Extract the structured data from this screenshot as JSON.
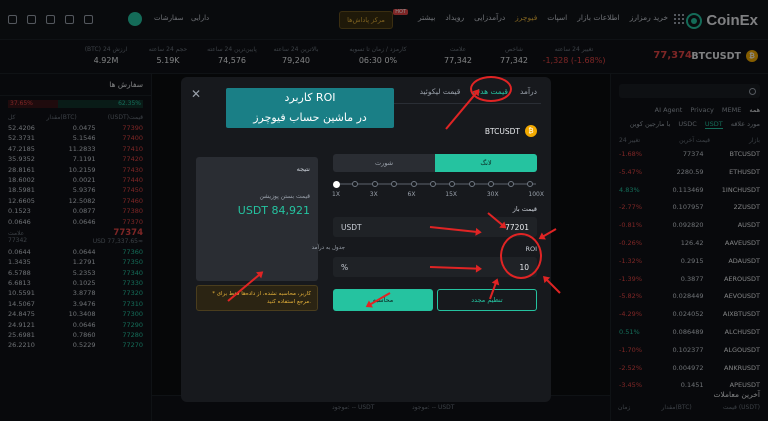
{
  "topbar": {
    "brand": "CoinEx",
    "nav": [
      {
        "label": "خرید رمزارز",
        "active": false
      },
      {
        "label": "اطلاعات بازار",
        "active": false
      },
      {
        "label": "اسپات",
        "active": false
      },
      {
        "label": "فیوچرز",
        "active": true
      },
      {
        "label": "درآمدزایی",
        "active": false
      },
      {
        "label": "رویداد",
        "active": false
      },
      {
        "label": "بیشتر",
        "active": false
      }
    ],
    "hot_badge": "HOT",
    "bot_button": "مرکز پاداش‌ها",
    "assets": "دارایی",
    "orders": "سفارشات"
  },
  "ticker": {
    "pair": "BTCUSDT",
    "price": "77,374",
    "stats": [
      {
        "k": "تغییر 24 ساعته",
        "v": "-1,328 (-1.68%)",
        "red": true
      },
      {
        "k": "شاخص",
        "v": "77,342",
        "red": false
      },
      {
        "k": "علامت",
        "v": "77,342",
        "red": false
      },
      {
        "k": "کارمزد / زمان تا تسویه",
        "v": "06:30 0%",
        "red": false
      },
      {
        "k": "بالاترین 24 ساعته",
        "v": "79,240",
        "red": false
      },
      {
        "k": "پایین‌ترین 24 ساعته",
        "v": "74,576",
        "red": false
      },
      {
        "k": "حجم 24 ساعته",
        "v": "5.19K",
        "red": false
      },
      {
        "k": "(BTC) ارزش 24",
        "v": "4.92M",
        "red": false
      }
    ]
  },
  "orderbook": {
    "title": "سفارش ها",
    "ratio_sell": "37.65%",
    "ratio_buy": "62.35%",
    "cols": [
      "(USDT)قیمت",
      "مقدار(BTC)",
      "کل"
    ],
    "asks": [
      {
        "p": "77390",
        "a": "0.0475",
        "t": "52.4206"
      },
      {
        "p": "77400",
        "a": "5.1546",
        "t": "52.3731"
      },
      {
        "p": "77410",
        "a": "11.2833",
        "t": "47.2185"
      },
      {
        "p": "77420",
        "a": "7.1191",
        "t": "35.9352"
      },
      {
        "p": "77430",
        "a": "10.2159",
        "t": "28.8161"
      },
      {
        "p": "77440",
        "a": "0.0021",
        "t": "18.6002"
      },
      {
        "p": "77450",
        "a": "5.9376",
        "t": "18.5981"
      },
      {
        "p": "77460",
        "a": "12.5082",
        "t": "12.6605"
      },
      {
        "p": "77380",
        "a": "0.0877",
        "t": "0.1523"
      },
      {
        "p": "77370",
        "a": "0.0646",
        "t": "0.0646"
      }
    ],
    "mid_price": "77374",
    "mid_sub": "USD 77,337.65≈",
    "mid_left_top": "علامت",
    "mid_left_bottom": "77342",
    "bids": [
      {
        "p": "77360",
        "a": "0.0644",
        "t": "0.0644"
      },
      {
        "p": "77350",
        "a": "1.2791",
        "t": "1.3435"
      },
      {
        "p": "77340",
        "a": "5.2353",
        "t": "6.5788"
      },
      {
        "p": "77330",
        "a": "0.1025",
        "t": "6.6813"
      },
      {
        "p": "77320",
        "a": "3.8778",
        "t": "10.5591"
      },
      {
        "p": "77310",
        "a": "3.9476",
        "t": "14.5067"
      },
      {
        "p": "77300",
        "a": "10.3408",
        "t": "24.8475"
      },
      {
        "p": "77290",
        "a": "0.0646",
        "t": "24.9121"
      },
      {
        "p": "77280",
        "a": "0.7860",
        "t": "25.6981"
      },
      {
        "p": "77270",
        "a": "0.5229",
        "t": "26.2210"
      }
    ]
  },
  "markets": {
    "search_placeholder": "جستجو",
    "tabs": [
      "همه",
      "MEME",
      "Privacy",
      "AI Agent"
    ],
    "subtabs": [
      "مورد علاقه",
      "USDT",
      "USDC",
      "با مارجین کوین"
    ],
    "cols": [
      "بازار",
      "قیمت آخرین",
      "تغییر 24"
    ],
    "rows": [
      {
        "s": "BTCUSDT",
        "p": "77374",
        "c": "-1.68%",
        "g": false
      },
      {
        "s": "ETHUSDT",
        "p": "2280.59",
        "c": "-5.47%",
        "g": false
      },
      {
        "s": "1INCHUSDT",
        "p": "0.113469",
        "c": "4.83%",
        "g": true
      },
      {
        "s": "2ZUSDT",
        "p": "0.107957",
        "c": "-2.77%",
        "g": false
      },
      {
        "s": "AUSDT",
        "p": "0.092820",
        "c": "-0.81%",
        "g": false
      },
      {
        "s": "AAVEUSDT",
        "p": "126.42",
        "c": "-0.26%",
        "g": false
      },
      {
        "s": "ADAUSDT",
        "p": "0.2915",
        "c": "-1.32%",
        "g": false
      },
      {
        "s": "AEROUSDT",
        "p": "0.3877",
        "c": "-1.39%",
        "g": false
      },
      {
        "s": "AEVOUSDT",
        "p": "0.028449",
        "c": "-5.82%",
        "g": false
      },
      {
        "s": "AIXBTUSDT",
        "p": "0.024052",
        "c": "-4.29%",
        "g": false
      },
      {
        "s": "ALCHUSDT",
        "p": "0.086489",
        "c": "0.51%",
        "g": true
      },
      {
        "s": "ALGOUSDT",
        "p": "0.102377",
        "c": "-1.70%",
        "g": false
      },
      {
        "s": "ANKRUSDT",
        "p": "0.004972",
        "c": "-2.52%",
        "g": false
      },
      {
        "s": "APEUSDT",
        "p": "0.1451",
        "c": "-3.45%",
        "g": false
      }
    ],
    "recent_title": "آخرین معاملات",
    "recent_cols": [
      "زمان",
      "مقدار(BTC)",
      "قیمت (USDT)"
    ]
  },
  "chartbottom": {
    "available1": "موجود: -- USDT",
    "available2": "موجود: -- USDT",
    "futures": "فیوچرز"
  },
  "modal": {
    "tabs": [
      {
        "label": "درآمد",
        "active": false
      },
      {
        "label": "قیمت هدف",
        "active": true
      },
      {
        "label": "قیمت لیکوئید",
        "active": false
      }
    ],
    "pair": "BTCUSDT",
    "annotation_line1": "کاربرد ROI",
    "annotation_line2": "در ماشین حساب فیوچرز",
    "toggle_long": "لانگ",
    "toggle_short": "شورت",
    "leverage_ticks": [
      "1X",
      "3X",
      "6X",
      "15X",
      "30X",
      "100X"
    ],
    "leverage_value": 0,
    "entry_label": "قیمت باز",
    "entry_value": "77201",
    "entry_unit": "USDT",
    "roi_label": "ROI",
    "roi_sublabel": "جدول به درآمد",
    "roi_value": "10",
    "roi_unit": "%",
    "result_title": "نتیجه",
    "result_key": "قیمت بستن پوزیشن",
    "result_value": "USDT 84,921",
    "warning": "* کاربر، محاسبه نشده، از داده‌ها فقط برای مرجع استفاده کنید.",
    "save_button": "تنظیم مجدد",
    "calc_button": "محاسبه"
  }
}
